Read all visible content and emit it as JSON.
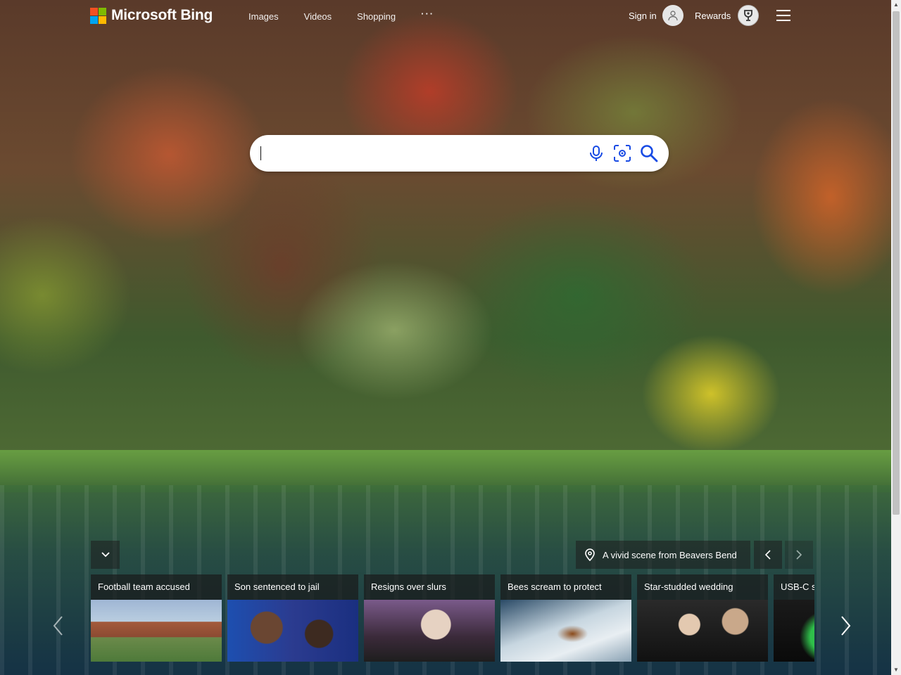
{
  "brand": {
    "name": "Microsoft Bing",
    "colors": [
      "#f25022",
      "#7fba00",
      "#00a4ef",
      "#ffb900"
    ]
  },
  "nav": {
    "items": [
      "Images",
      "Videos",
      "Shopping"
    ],
    "more": "···"
  },
  "account": {
    "sign_in": "Sign in",
    "rewards": "Rewards"
  },
  "search": {
    "value": "",
    "placeholder": ""
  },
  "image_caption": {
    "text": "A vivid scene from Beavers Bend"
  },
  "news": [
    {
      "title": "Football team accused"
    },
    {
      "title": "Son sentenced to jail"
    },
    {
      "title": "Resigns over slurs"
    },
    {
      "title": "Bees scream to protect"
    },
    {
      "title": "Star-studded wedding"
    },
    {
      "title": "USB-C s"
    }
  ],
  "icons": {
    "microphone": "microphone-icon",
    "visual_search": "visual-search-icon",
    "search": "search-icon",
    "location": "location-pin-icon",
    "menu": "hamburger-menu-icon",
    "rewards": "rewards-trophy-icon"
  },
  "accent_color": "#174ae4"
}
